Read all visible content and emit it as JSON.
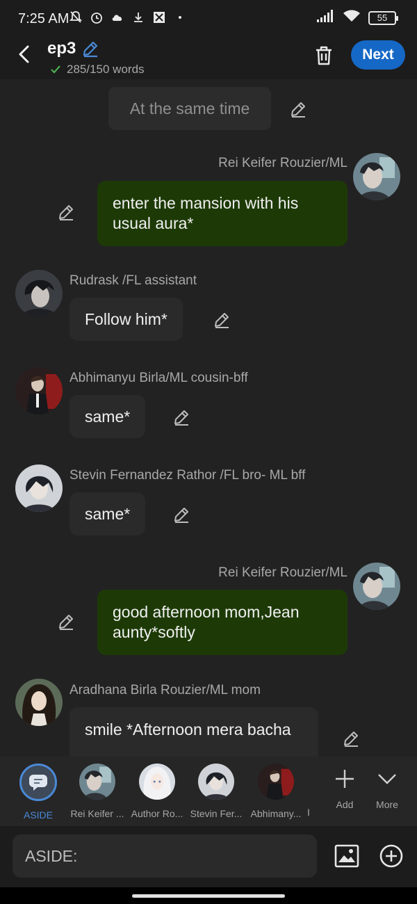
{
  "status_bar": {
    "time": "7:25 AM",
    "battery": "55",
    "icons": [
      "mute-bell-icon",
      "alarm-icon",
      "cloud-icon",
      "download-icon",
      "app-icon",
      "dot-icon",
      "signal-icon",
      "wifi-icon",
      "battery-icon"
    ]
  },
  "header": {
    "title": "ep3",
    "word_count": "285/150 words",
    "next_label": "Next"
  },
  "messages": {
    "aside_text": "At the same time",
    "m1": {
      "speaker": "Rei Keifer Rouzier/ML",
      "text": "enter the mansion with his usual aura*"
    },
    "m2": {
      "speaker": "Rudrask /FL assistant",
      "text": "Follow him*"
    },
    "m3": {
      "speaker": "Abhimanyu Birla/ML cousin-bff",
      "text": "same*"
    },
    "m4": {
      "speaker": "Stevin Fernandez Rathor /FL bro- ML bff",
      "text": "same*"
    },
    "m5": {
      "speaker": "Rei Keifer Rouzier/ML",
      "text": "good afternoon mom,Jean aunty*softly"
    },
    "m6": {
      "speaker": "Aradhana Birla Rouzier/ML mom",
      "text": "smile *Afternoon mera bacha"
    }
  },
  "character_bar": {
    "aside": "ASIDE",
    "c1": "Rei Keifer ...",
    "c2": "Author Ro...",
    "c3": "Stevin Fer...",
    "c4": "Abhimany...",
    "c5": "I",
    "add": "Add",
    "more": "More"
  },
  "composer": {
    "placeholder": "ASIDE:"
  },
  "colors": {
    "accent": "#1668c6",
    "own_bubble": "#1d3a06",
    "other_bubble": "#2a2a2a",
    "background": "#222222"
  }
}
